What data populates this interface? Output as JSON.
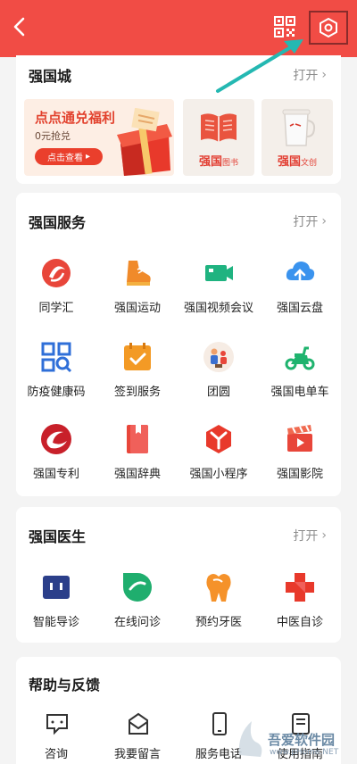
{
  "mall": {
    "title": "强国城",
    "open_label": "打开",
    "promo": {
      "title": "点点通兑福利",
      "subtitle": "0元抢兑",
      "button": "点击查看"
    },
    "tiles": [
      {
        "brand": "强国",
        "sub": "图书"
      },
      {
        "brand": "强国",
        "sub": "文创"
      }
    ]
  },
  "services": {
    "title": "强国服务",
    "open_label": "打开",
    "items": [
      {
        "label": "同学汇",
        "icon": "tongxuehui-icon"
      },
      {
        "label": "强国运动",
        "icon": "sport-shoe-icon"
      },
      {
        "label": "强国视频会议",
        "icon": "video-meeting-icon"
      },
      {
        "label": "强国云盘",
        "icon": "cloud-upload-icon"
      },
      {
        "label": "防疫健康码",
        "icon": "health-qr-icon"
      },
      {
        "label": "签到服务",
        "icon": "checkin-icon"
      },
      {
        "label": "团圆",
        "icon": "reunion-icon"
      },
      {
        "label": "强国电单车",
        "icon": "ebike-icon"
      },
      {
        "label": "强国专利",
        "icon": "patent-icon"
      },
      {
        "label": "强国辞典",
        "icon": "dictionary-icon"
      },
      {
        "label": "强国小程序",
        "icon": "mini-program-icon"
      },
      {
        "label": "强国影院",
        "icon": "cinema-icon"
      }
    ]
  },
  "doctor": {
    "title": "强国医生",
    "open_label": "打开",
    "items": [
      {
        "label": "智能导诊",
        "icon": "smart-guide-icon"
      },
      {
        "label": "在线问诊",
        "icon": "online-consult-icon"
      },
      {
        "label": "预约牙医",
        "icon": "tooth-icon"
      },
      {
        "label": "中医自诊",
        "icon": "medical-cross-icon"
      }
    ]
  },
  "help": {
    "title": "帮助与反馈",
    "items": [
      {
        "label": "咨询",
        "icon": "chat-icon"
      },
      {
        "label": "我要留言",
        "icon": "mail-icon"
      },
      {
        "label": "服务电话",
        "icon": "phone-icon"
      },
      {
        "label": "使用指南",
        "icon": "guide-icon"
      }
    ]
  },
  "watermark": {
    "text": "吾爱软件园",
    "url": "www.pHome.NET"
  },
  "colors": {
    "brand_red": "#f14c45",
    "accent_red": "#e23d31",
    "arrow": "#24b8b2"
  }
}
